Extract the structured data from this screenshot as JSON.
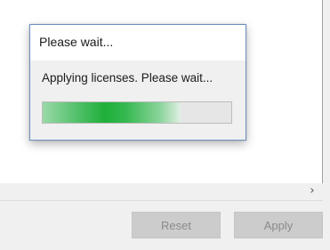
{
  "dialog": {
    "title": "Please wait...",
    "message": "Applying licenses. Please wait...",
    "progress": 0.73
  },
  "scrollbar": {
    "right_arrow": "›",
    "right_arrow_icon": "chevron-right-icon"
  },
  "buttons": {
    "reset_label": "Reset",
    "apply_label": "Apply"
  },
  "colors": {
    "progress_green": "#1faf3a",
    "dialog_border": "#6e8fbf",
    "disabled_button": "#cccccc"
  }
}
